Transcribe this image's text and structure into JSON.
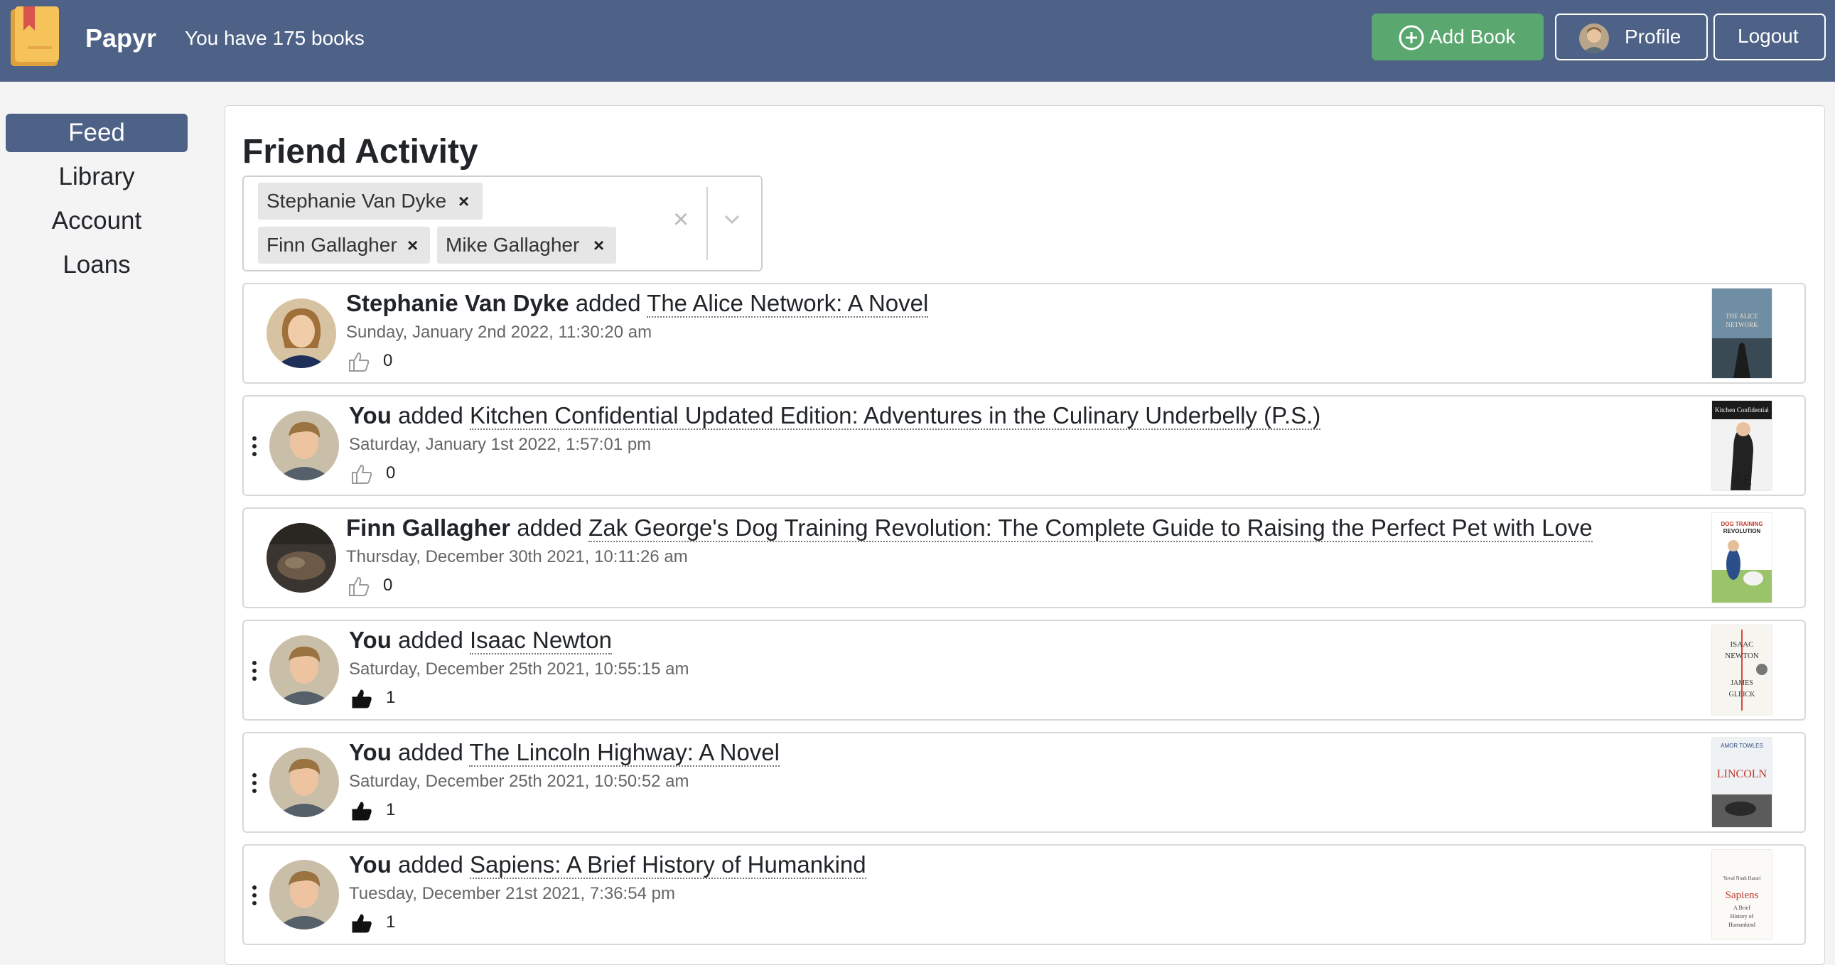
{
  "app": {
    "name": "Papyr",
    "book_count_text": "You have 175 books"
  },
  "header": {
    "add_book_label": "Add Book",
    "profile_label": "Profile",
    "logout_label": "Logout"
  },
  "sidebar": {
    "items": [
      {
        "label": "Feed",
        "active": true
      },
      {
        "label": "Library",
        "active": false
      },
      {
        "label": "Account",
        "active": false
      },
      {
        "label": "Loans",
        "active": false
      }
    ]
  },
  "main": {
    "title": "Friend Activity",
    "filter": {
      "selected": [
        "Stephanie Van Dyke",
        "Finn Gallagher",
        "Mike Gallagher"
      ],
      "remove_glyph": "×",
      "clear_glyph": "×"
    },
    "feed": [
      {
        "who": "Stephanie Van Dyke",
        "verb": "added",
        "book": "The Alice Network: A Novel",
        "timestamp": "Sunday, January 2nd 2022, 11:30:20 am",
        "likes": "0",
        "liked": false,
        "own": false
      },
      {
        "who": "You",
        "verb": "added",
        "book": "Kitchen Confidential Updated Edition: Adventures in the Culinary Underbelly (P.S.)",
        "timestamp": "Saturday, January 1st 2022, 1:57:01 pm",
        "likes": "0",
        "liked": false,
        "own": true
      },
      {
        "who": "Finn Gallagher",
        "verb": "added",
        "book": "Zak George's Dog Training Revolution: The Complete Guide to Raising the Perfect Pet with Love",
        "timestamp": "Thursday, December 30th 2021, 10:11:26 am",
        "likes": "0",
        "liked": false,
        "own": false
      },
      {
        "who": "You",
        "verb": "added",
        "book": "Isaac Newton",
        "timestamp": "Saturday, December 25th 2021, 10:55:15 am",
        "likes": "1",
        "liked": true,
        "own": true
      },
      {
        "who": "You",
        "verb": "added",
        "book": "The Lincoln Highway: A Novel",
        "timestamp": "Saturday, December 25th 2021, 10:50:52 am",
        "likes": "1",
        "liked": true,
        "own": true
      },
      {
        "who": "You",
        "verb": "added",
        "book": "Sapiens: A Brief History of Humankind",
        "timestamp": "Tuesday, December 21st 2021, 7:36:54 pm",
        "likes": "1",
        "liked": true,
        "own": true
      }
    ]
  },
  "colors": {
    "navbar": "#4e6287",
    "add_button": "#5aa76f",
    "sidebar_active": "#4e6287"
  },
  "icons": {
    "logo": "book-logo-icon",
    "add": "plus-circle-icon",
    "like": "thumbs-up-icon",
    "menu": "vertical-ellipsis-icon",
    "dropdown": "chevron-down-icon"
  }
}
